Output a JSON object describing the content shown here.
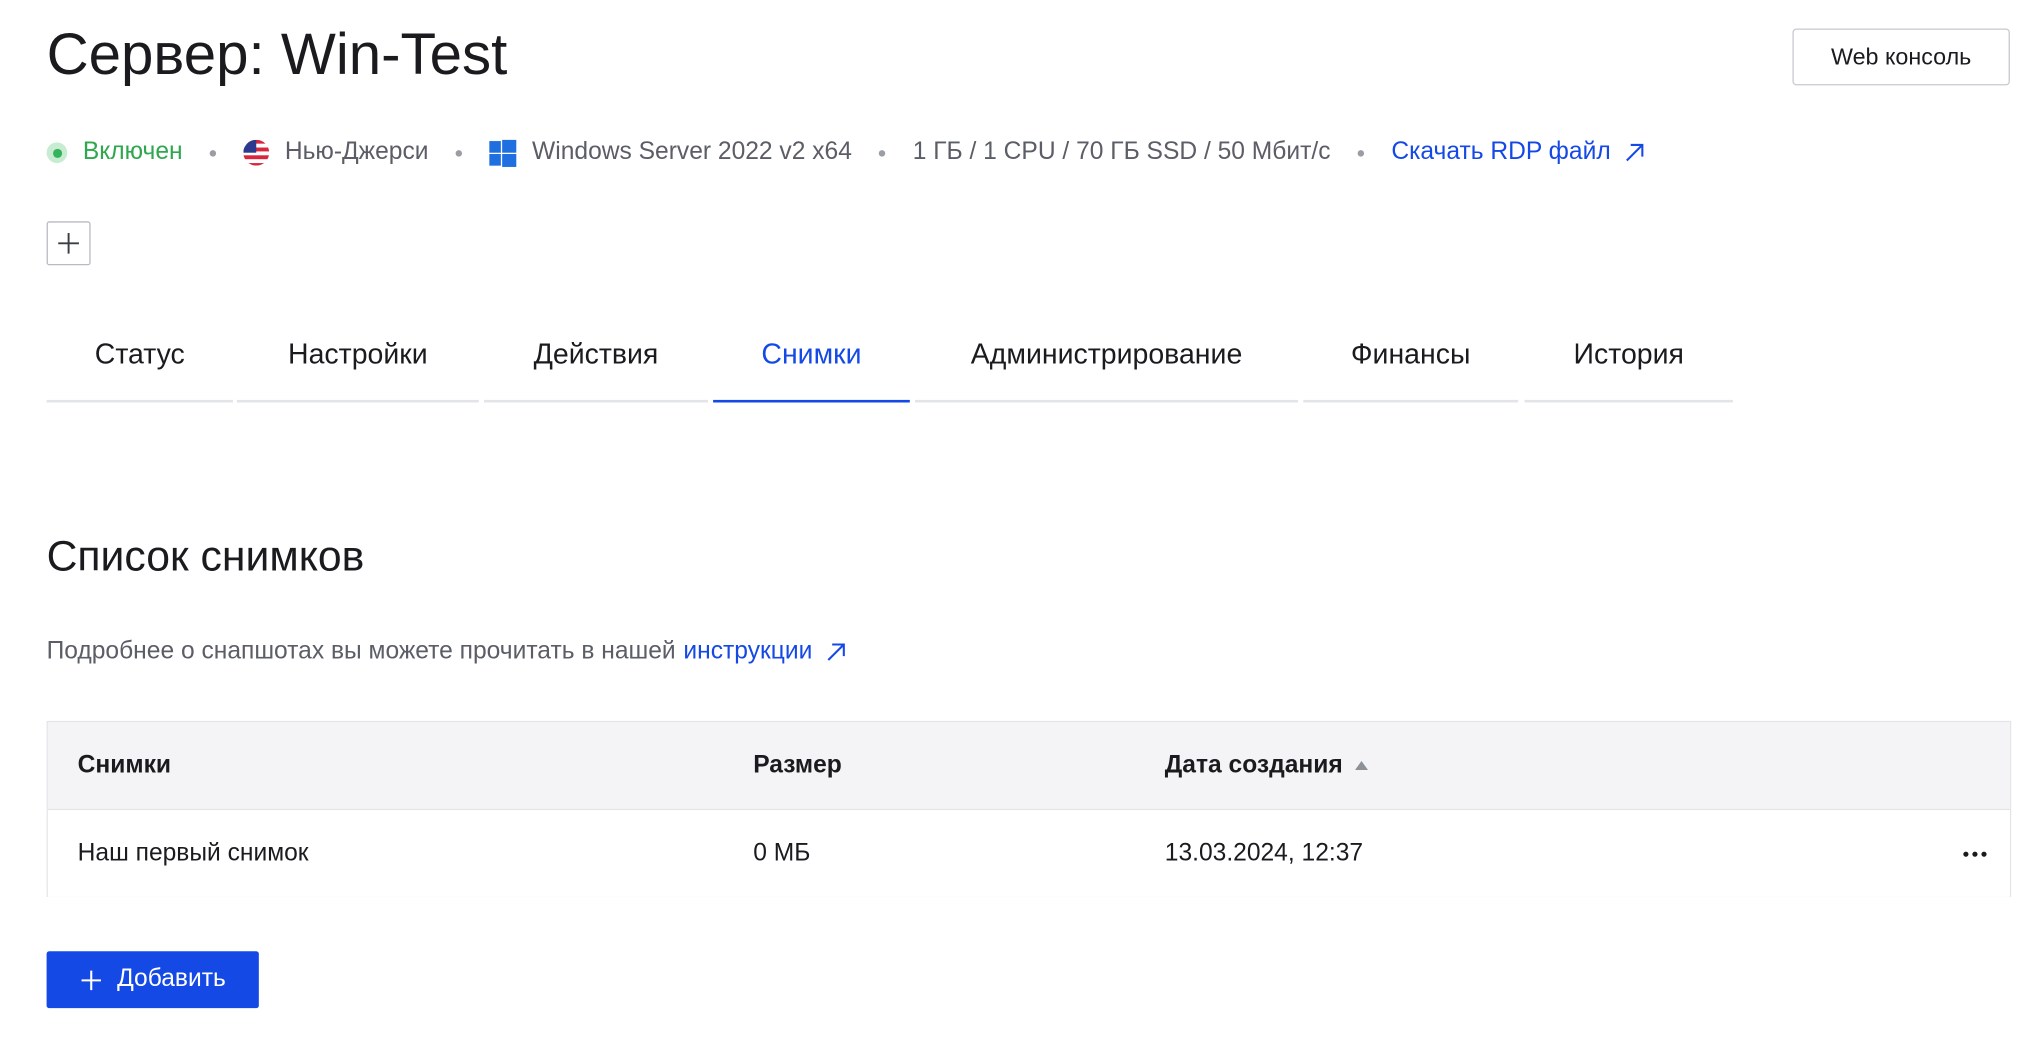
{
  "header": {
    "title": "Сервер: Win-Test",
    "web_console_label": "Web консоль"
  },
  "meta": {
    "status": "Включен",
    "location": "Нью-Джерси",
    "os": "Windows Server 2022 v2 x64",
    "specs": "1 ГБ / 1 CPU / 70 ГБ SSD / 50 Мбит/с",
    "rdp_link": "Скачать RDP файл"
  },
  "tabs": [
    {
      "label": "Статус"
    },
    {
      "label": "Настройки"
    },
    {
      "label": "Действия"
    },
    {
      "label": "Снимки",
      "active": true
    },
    {
      "label": "Администрирование"
    },
    {
      "label": "Финансы"
    },
    {
      "label": "История"
    }
  ],
  "section": {
    "title": "Список снимков",
    "info_text": "Подробнее о снапшотах вы можете прочитать в нашей",
    "info_link": "инструкции"
  },
  "table": {
    "columns": [
      "Снимки",
      "Размер",
      "Дата создания"
    ],
    "sorted_column": "Дата создания",
    "sort_direction": "asc",
    "rows": [
      {
        "name": "Наш первый снимок",
        "size": "0 МБ",
        "created": "13.03.2024, 12:37"
      }
    ]
  },
  "add_button_label": "Добавить",
  "colors": {
    "accent": "#1549e5",
    "status_green": "#2fa74f",
    "muted_text": "#5b5e66",
    "table_header_bg": "#f4f4f6"
  },
  "icons": {
    "status": "status-dot-icon",
    "location": "us-flag-icon",
    "os": "windows-logo-icon",
    "external": "external-link-icon",
    "plus": "plus-icon",
    "more": "more-dots-icon",
    "sort": "sort-asc-icon"
  }
}
